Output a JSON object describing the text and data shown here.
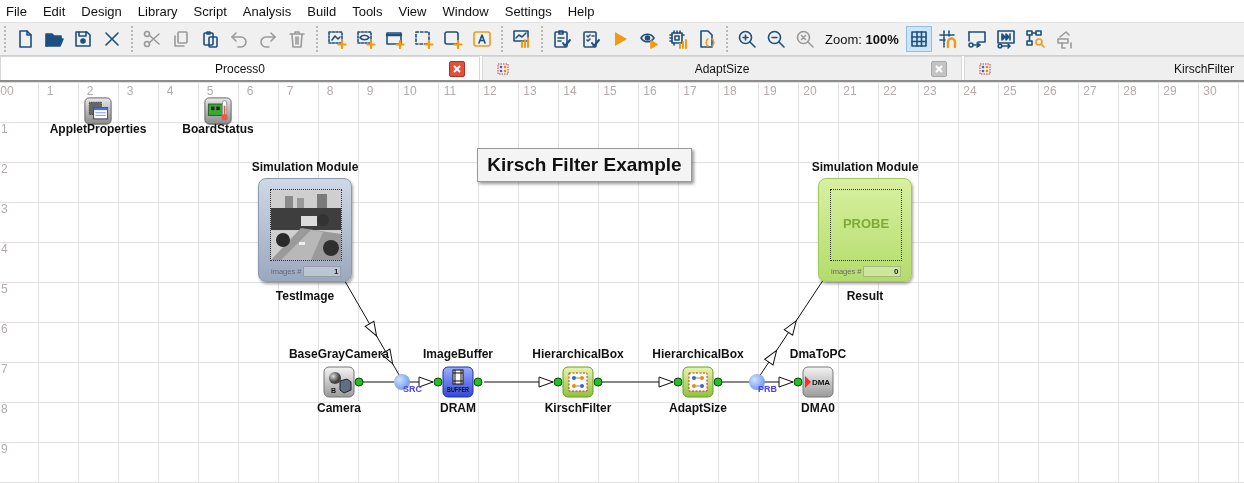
{
  "menu": [
    "File",
    "Edit",
    "Design",
    "Library",
    "Script",
    "Analysis",
    "Build",
    "Tools",
    "View",
    "Window",
    "Settings",
    "Help"
  ],
  "toolbar": [
    [
      {
        "kind": "new",
        "disabled": false
      },
      {
        "kind": "open",
        "disabled": false
      },
      {
        "kind": "save",
        "disabled": false
      },
      {
        "kind": "close",
        "disabled": false
      }
    ],
    [
      {
        "kind": "cut",
        "disabled": true
      },
      {
        "kind": "copy",
        "disabled": true
      },
      {
        "kind": "paste",
        "disabled": false
      },
      {
        "kind": "undo",
        "disabled": true
      },
      {
        "kind": "redo",
        "disabled": true
      },
      {
        "kind": "delete",
        "disabled": true
      }
    ],
    [
      {
        "kind": "add-image",
        "disabled": false
      },
      {
        "kind": "add-view",
        "disabled": false
      },
      {
        "kind": "add-window",
        "disabled": false
      },
      {
        "kind": "add-select",
        "disabled": false
      },
      {
        "kind": "add-box",
        "disabled": false
      },
      {
        "kind": "add-text",
        "disabled": false
      }
    ],
    [
      {
        "kind": "chart",
        "disabled": false
      }
    ],
    [
      {
        "kind": "check",
        "disabled": false
      },
      {
        "kind": "check-all",
        "disabled": false
      },
      {
        "kind": "run",
        "disabled": false
      },
      {
        "kind": "watch",
        "disabled": false
      },
      {
        "kind": "chip",
        "disabled": false
      },
      {
        "kind": "code",
        "disabled": false
      }
    ],
    [
      {
        "kind": "zoom-in",
        "disabled": false
      },
      {
        "kind": "zoom-out",
        "disabled": false
      },
      {
        "kind": "zoom-reset",
        "disabled": true
      },
      {
        "kind": "zoom-label",
        "label": "Zoom:",
        "value": "100%"
      },
      {
        "kind": "grid",
        "disabled": false,
        "selected": true
      },
      {
        "kind": "snap",
        "disabled": false,
        "selected": false
      },
      {
        "kind": "frame",
        "disabled": false,
        "selected": false
      },
      {
        "kind": "step",
        "disabled": false,
        "selected": false
      },
      {
        "kind": "tree",
        "disabled": false,
        "selected": false
      },
      {
        "kind": "paint",
        "disabled": true,
        "selected": false
      }
    ]
  ],
  "tabs": [
    {
      "label": "Process0",
      "selected": true,
      "has_icon": false,
      "close_active": true
    },
    {
      "label": "AdaptSize",
      "selected": false,
      "has_icon": true,
      "close_active": false
    },
    {
      "label": "KirschFilter",
      "selected": false,
      "has_icon": true
    }
  ],
  "canvas": {
    "column_numbers": [
      "00",
      "1",
      "2",
      "3",
      "4",
      "5",
      "6",
      "7",
      "8",
      "9",
      "10",
      "11",
      "12",
      "13",
      "14",
      "15",
      "16",
      "17",
      "18",
      "19",
      "20",
      "21",
      "22",
      "23",
      "24",
      "25",
      "26",
      "27",
      "28",
      "29",
      "30"
    ],
    "row_numbers": [
      "1",
      "2",
      "3",
      "4",
      "5",
      "6",
      "7",
      "8",
      "9"
    ],
    "comment": "Kirsch Filter Example",
    "tools": [
      {
        "label": "AppletProperties",
        "kind": "properties"
      },
      {
        "label": "BoardStatus",
        "kind": "status"
      }
    ],
    "simulations": [
      {
        "kind": "source",
        "title": "Simulation Module",
        "label": "TestImage",
        "counter_label": "images #",
        "count": "1"
      },
      {
        "kind": "probe",
        "title": "Simulation Module",
        "label": "Result",
        "counter_label": "images #",
        "count": "0",
        "watermark": "PROBE"
      }
    ],
    "blocks": [
      {
        "type": "BaseGrayCamera",
        "label": "Camera",
        "kind": "camera",
        "badge": "B"
      },
      {
        "type": "ImageBuffer",
        "label": "DRAM",
        "kind": "buffer",
        "badge": "BUFFER"
      },
      {
        "type": "HierarchicalBox",
        "label": "KirschFilter",
        "kind": "hierarchical"
      },
      {
        "type": "HierarchicalBox",
        "label": "AdaptSize",
        "kind": "hierarchical"
      },
      {
        "type": "DmaToPC",
        "label": "DMA0",
        "kind": "dma",
        "badge": "DMA"
      }
    ],
    "junctions": [
      {
        "label": "SRC"
      },
      {
        "label": "PRB"
      }
    ]
  }
}
